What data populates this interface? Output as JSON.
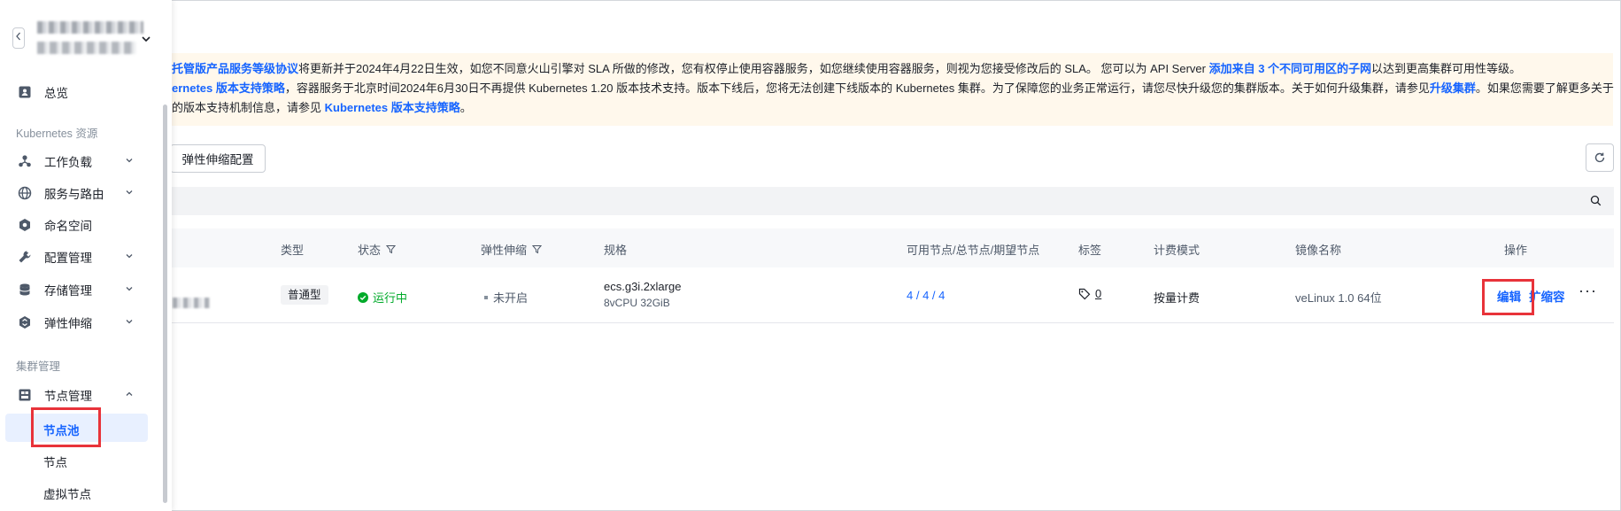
{
  "sidebar": {
    "overview": "总览",
    "section_k8s": "Kubernetes 资源",
    "items": [
      {
        "label": "工作负载",
        "icon": "workload-icon"
      },
      {
        "label": "服务与路由",
        "icon": "globe-icon"
      },
      {
        "label": "命名空间",
        "icon": "namespace-icon"
      },
      {
        "label": "配置管理",
        "icon": "wrench-icon"
      },
      {
        "label": "存储管理",
        "icon": "database-icon"
      },
      {
        "label": "弹性伸缩",
        "icon": "scaling-icon"
      }
    ],
    "section_cluster": "集群管理",
    "node_mgmt": "节点管理",
    "sub_items": [
      "节点池",
      "节点",
      "虚拟节点"
    ]
  },
  "notice": {
    "line1_link1": "托管版产品服务等级协议",
    "line1_text1": "将更新并于2024年4月22日生效，如您不同意火山引擎对 SLA 所做的修改，您有权停止使用容器服务，如您继续使用容器服务，则视为您接受修改后的 SLA。 您可以为 API Server ",
    "line1_link2": "添加来自 3 个不同可用区的子网",
    "line1_text2": "以达到更高集群可用性等级。",
    "line2_link1": "ernetes 版本支持策略",
    "line2_text1": "，容器服务于北京时间2024年6月30日不再提供 Kubernetes 1.20 版本技术支持。版本下线后，您将无法创建下线版本的 Kubernetes 集群。为了保障您的业务正常运行，请您尽快升级您的集群版本。关于如何升级集群，请参见",
    "line2_link2": "升级集群",
    "line2_text2": "。如果您需要了解更多关于",
    "line3_text1": "的版本支持机制信息，请参见 ",
    "line3_link1": "Kubernetes 版本支持策略",
    "line3_text2": "。"
  },
  "toolbar": {
    "scaling_config": "弹性伸缩配置"
  },
  "table": {
    "headers": {
      "type": "类型",
      "status": "状态",
      "scaling": "弹性伸缩",
      "spec": "规格",
      "nodes": "可用节点/总节点/期望节点",
      "tags": "标签",
      "billing": "计费模式",
      "image": "镜像名称",
      "ops": "操作"
    },
    "row": {
      "type": "普通型",
      "status": "运行中",
      "scaling": "未开启",
      "spec_name": "ecs.g3i.2xlarge",
      "spec_detail": "8vCPU 32GiB",
      "nodes": "4 / 4 / 4",
      "tags": "0",
      "billing": "按量计费",
      "image": "veLinux 1.0 64位",
      "op_edit": "编辑",
      "op_scale": "扩缩容",
      "op_more": "···"
    }
  },
  "colors": {
    "accent": "#1664ff",
    "running": "#00aa2a",
    "highlight": "#e8333a",
    "notice_bg": "#fff8ec"
  }
}
